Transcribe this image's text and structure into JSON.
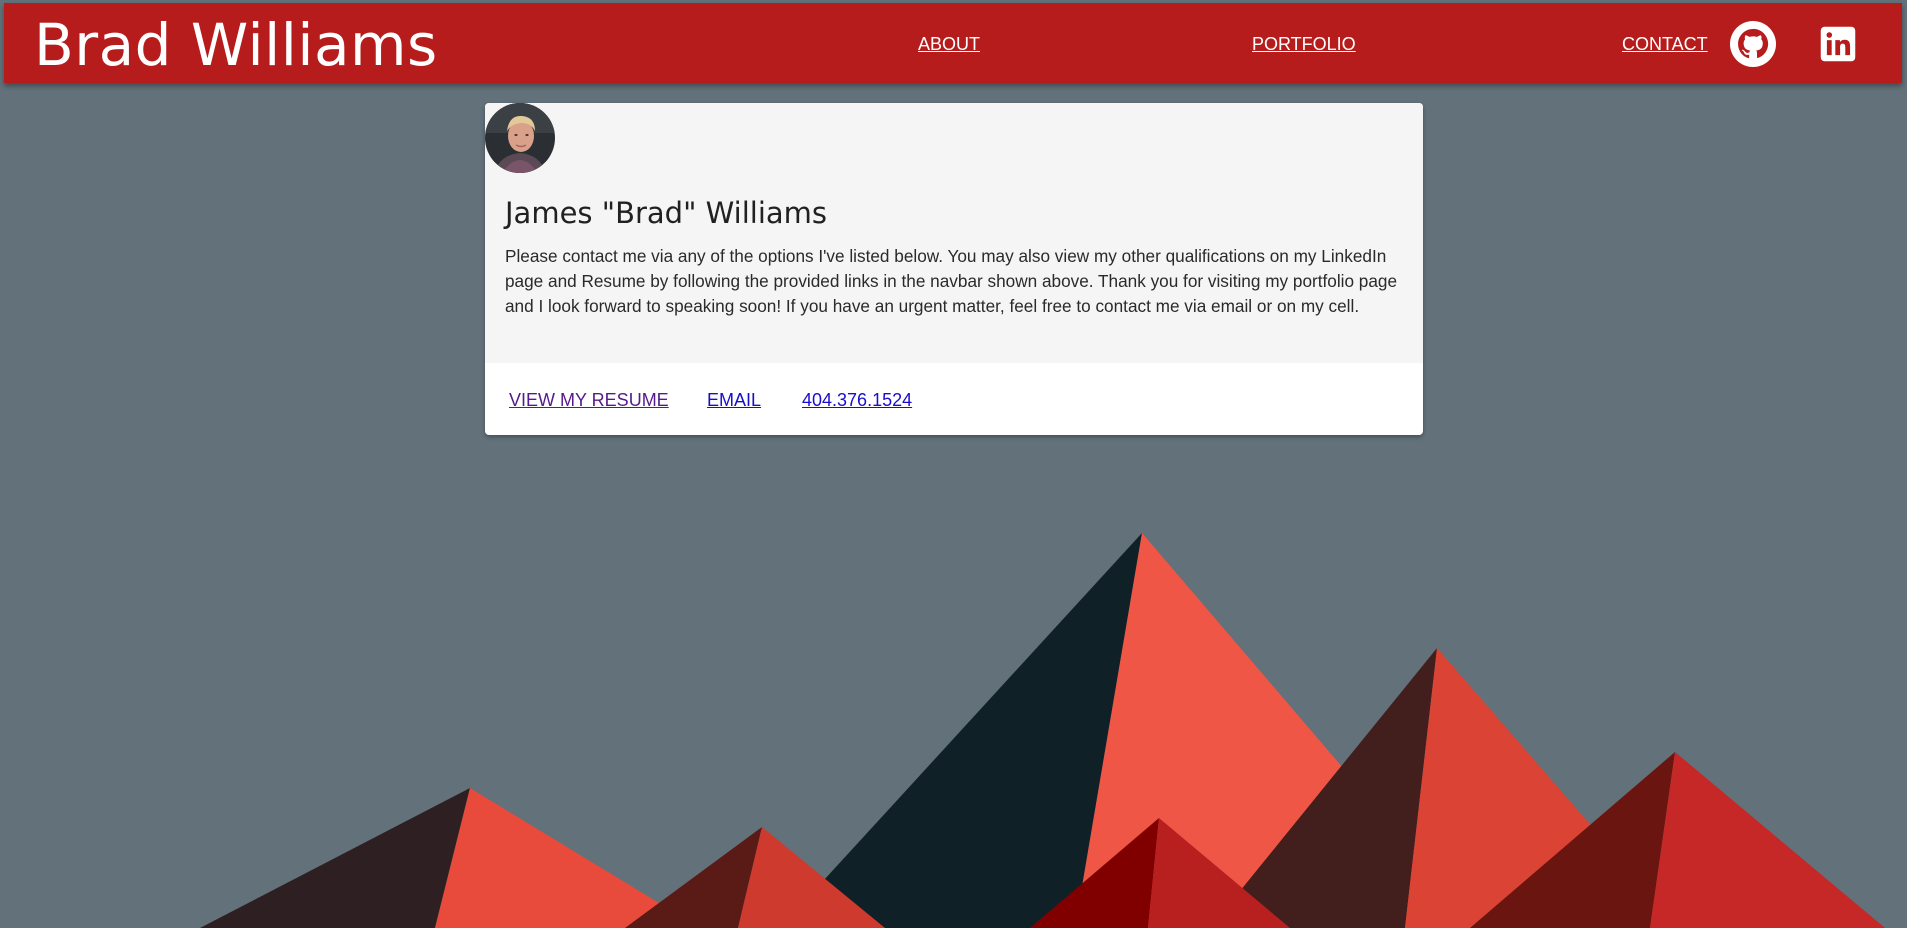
{
  "navbar": {
    "brand": "Brad Williams",
    "links": [
      {
        "label": "ABOUT"
      },
      {
        "label": "PORTFOLIO"
      },
      {
        "label": "CONTACT"
      }
    ],
    "icons": [
      "github-icon",
      "linkedin-icon"
    ],
    "background_color": "#b71c1c"
  },
  "card": {
    "title": "James \"Brad\" Williams",
    "text": "Please contact me via any of the options I've listed below. You may also view my other qualifications on my LinkedIn page and Resume by following the provided links in the navbar shown above. Thank you for visiting my portfolio page and I look forward to speaking soon! If you have an urgent matter, feel free to contact me via email or on my cell.",
    "actions": [
      {
        "label": "VIEW MY RESUME"
      },
      {
        "label": "EMAIL"
      },
      {
        "label": "404.376.1524"
      }
    ]
  },
  "colors": {
    "page_background": "#62717a",
    "accent": "#b71c1c"
  }
}
